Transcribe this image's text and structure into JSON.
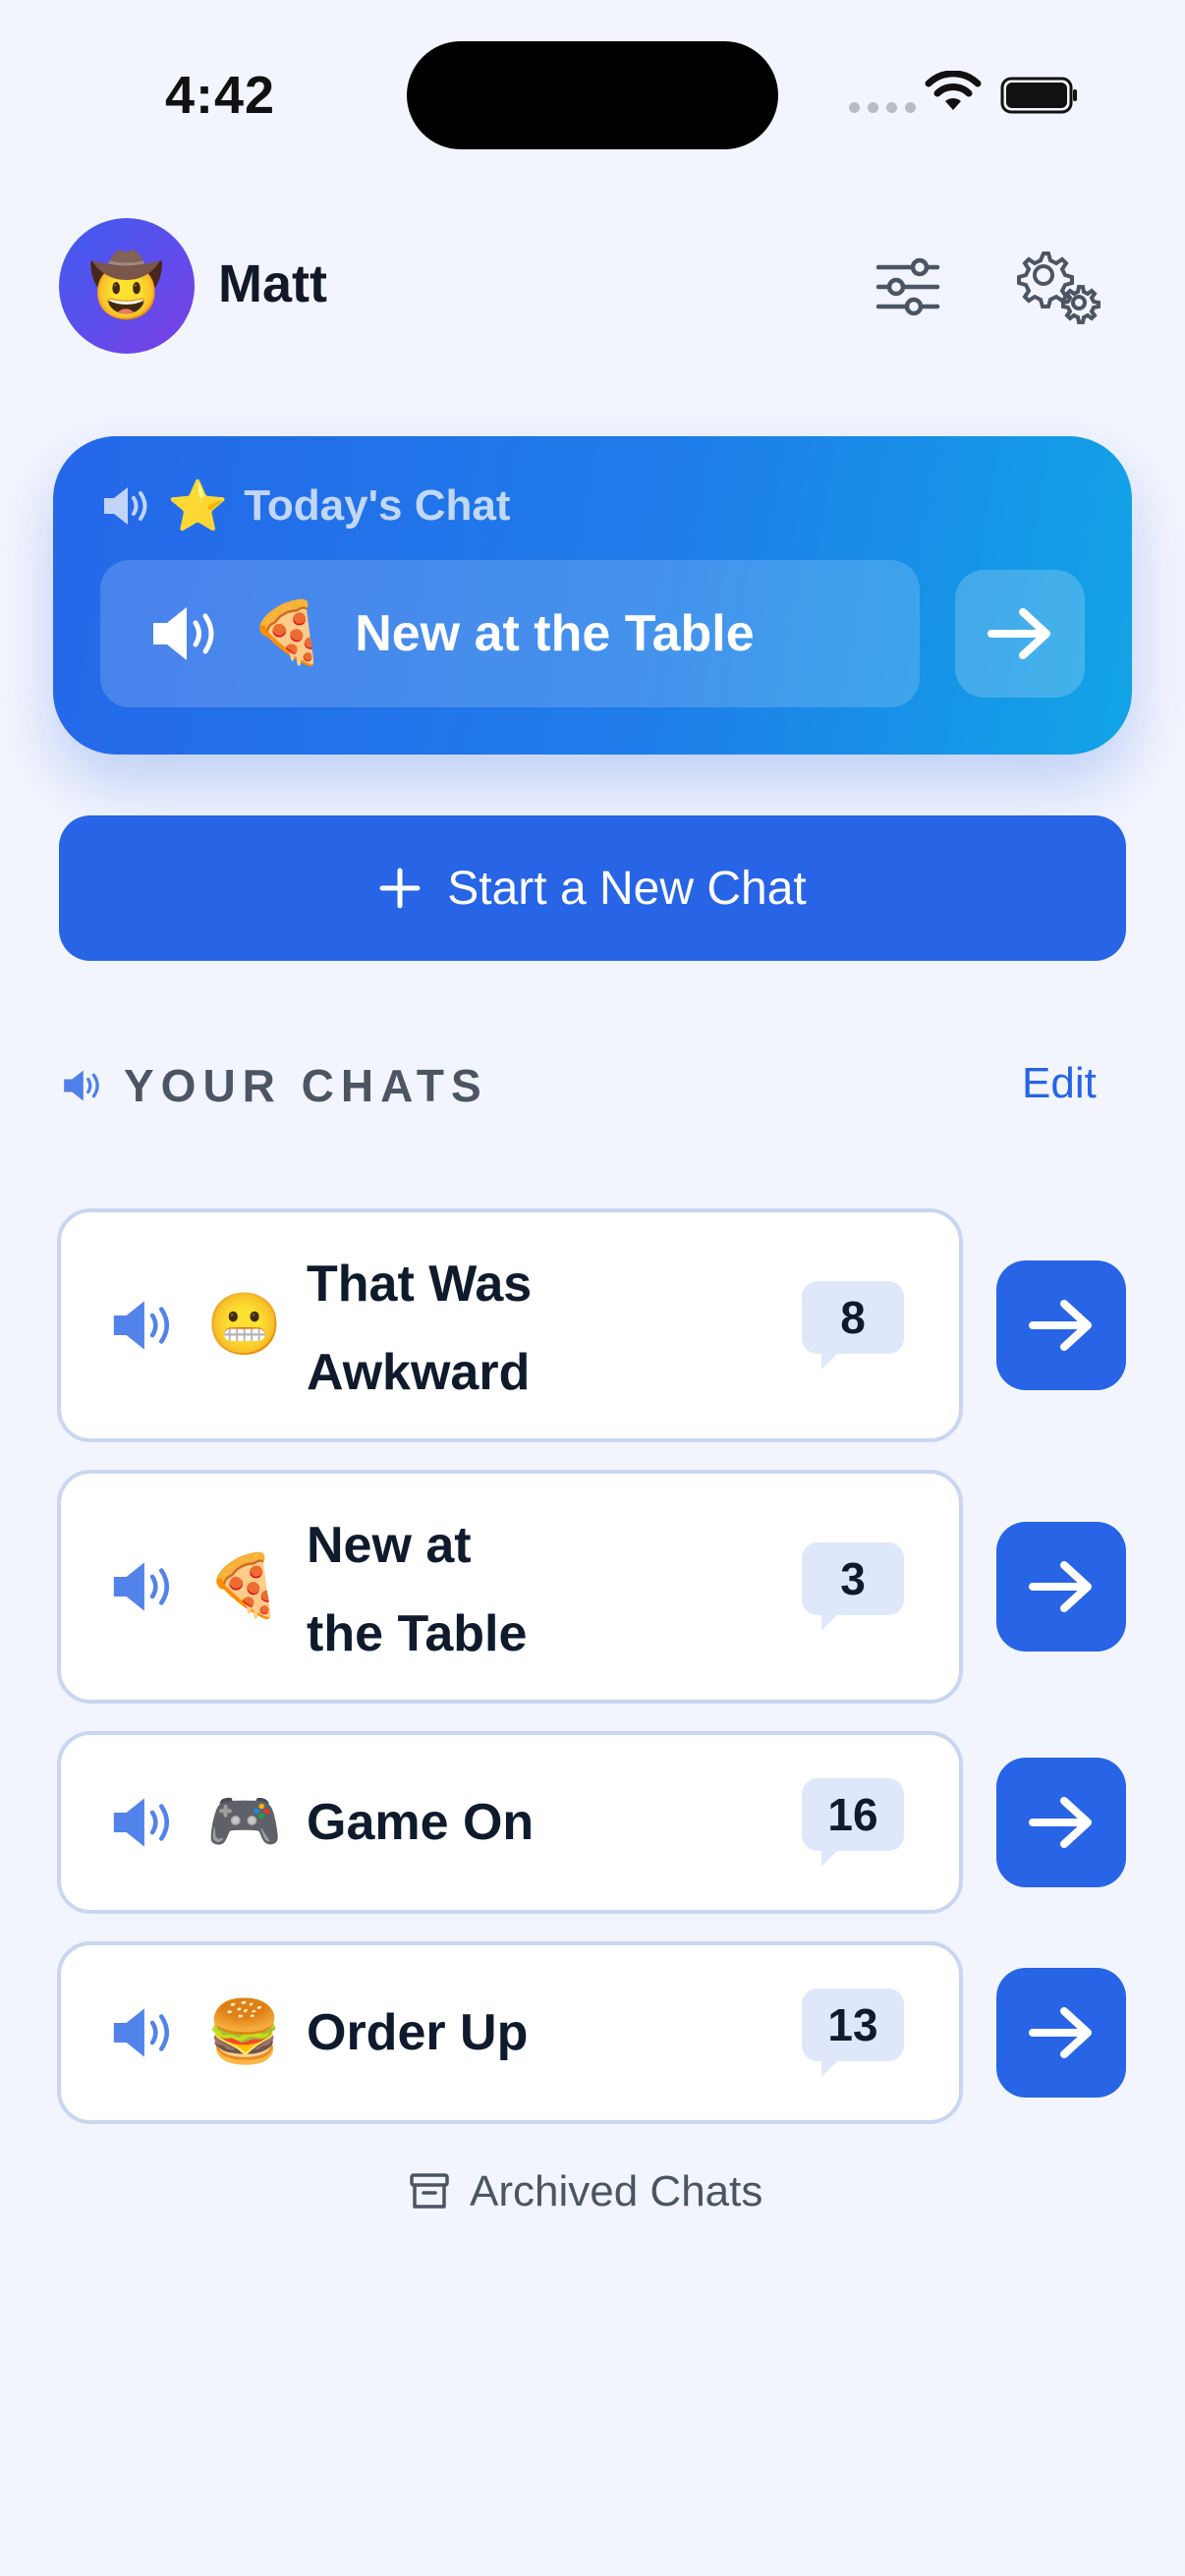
{
  "status_bar": {
    "time": "4:42"
  },
  "header": {
    "avatar_emoji": "🤠",
    "user_name": "Matt",
    "filter_icon": "sliders-icon",
    "settings_icon": "gears-icon"
  },
  "today": {
    "label": "Today's Chat",
    "star": "⭐",
    "chat_emoji": "🍕",
    "chat_title": "New at the Table"
  },
  "new_chat": {
    "label": "Start a New Chat"
  },
  "section": {
    "title": "YOUR CHATS",
    "edit": "Edit"
  },
  "chats": [
    {
      "emoji": "😬",
      "title_line1": "That Was",
      "title_line2": "Awkward",
      "count": "8"
    },
    {
      "emoji": "🍕",
      "title_line1": "New at",
      "title_line2": "the Table",
      "count": "3"
    },
    {
      "emoji": "🎮",
      "title_line1": "Game On",
      "title_line2": "",
      "count": "16"
    },
    {
      "emoji": "🍔",
      "title_line1": "Order Up",
      "title_line2": "",
      "count": "13"
    }
  ],
  "archived": {
    "label": "Archived Chats"
  },
  "colors": {
    "background": "#f2f5fd",
    "accent": "#2764e6",
    "card_border": "#c8d6f1",
    "badge": "#dfe8fb"
  }
}
